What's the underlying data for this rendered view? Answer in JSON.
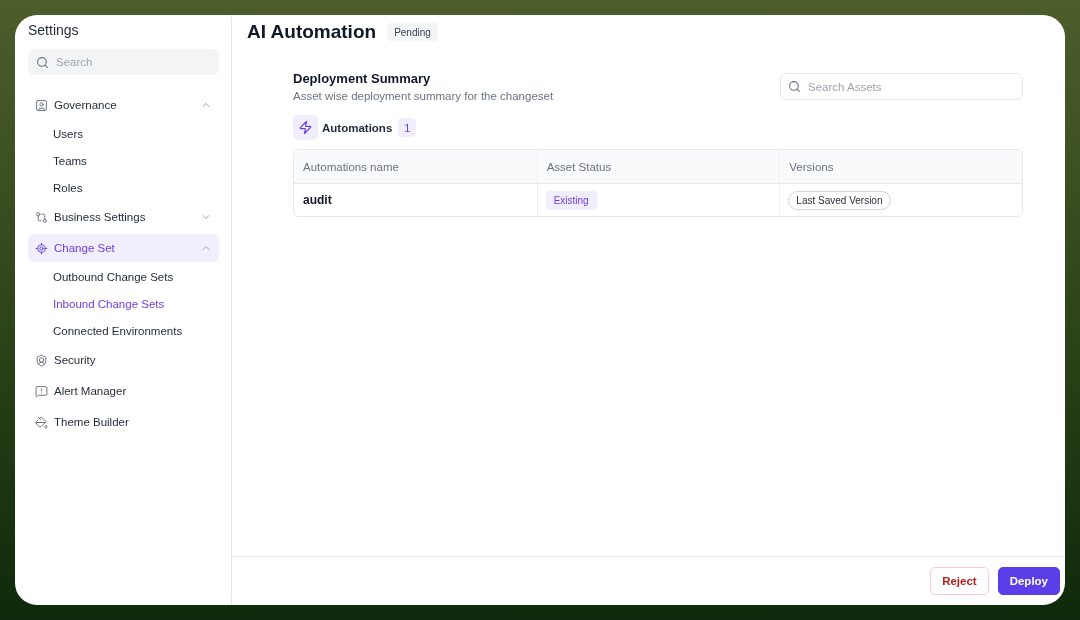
{
  "sidebar": {
    "title": "Settings",
    "search": {
      "placeholder": "Search"
    },
    "items": [
      {
        "label": "Governance",
        "selected": false,
        "expanded": true,
        "children": [
          {
            "label": "Users",
            "selected": false
          },
          {
            "label": "Teams",
            "selected": false
          },
          {
            "label": "Roles",
            "selected": false
          }
        ]
      },
      {
        "label": "Business Settings",
        "selected": false,
        "expanded": false
      },
      {
        "label": "Change Set",
        "selected": true,
        "expanded": true,
        "children": [
          {
            "label": "Outbound Change Sets",
            "selected": false
          },
          {
            "label": "Inbound Change Sets",
            "selected": true
          },
          {
            "label": "Connected Environments",
            "selected": false
          }
        ]
      },
      {
        "label": "Security",
        "selected": false
      },
      {
        "label": "Alert Manager",
        "selected": false
      },
      {
        "label": "Theme Builder",
        "selected": false
      }
    ]
  },
  "header": {
    "title": "AI Automation",
    "status": "Pending"
  },
  "summary": {
    "title": "Deployment Summary",
    "subtitle": "Asset wise deployment summary for the changeset",
    "search": {
      "placeholder": "Search Assets"
    }
  },
  "asset_group": {
    "label": "Automations",
    "count": "1"
  },
  "table": {
    "columns": [
      "Automations name",
      "Asset Status",
      "Versions"
    ],
    "rows": [
      {
        "cells": [
          {
            "kind": "text",
            "text": "audit"
          },
          {
            "kind": "status",
            "text": "Existing"
          },
          {
            "kind": "version",
            "text": "Last Saved Version"
          }
        ]
      }
    ]
  },
  "footer": {
    "buttons": [
      {
        "label": "Reject",
        "kind": "danger"
      },
      {
        "label": "Deploy",
        "kind": "primary"
      }
    ]
  }
}
